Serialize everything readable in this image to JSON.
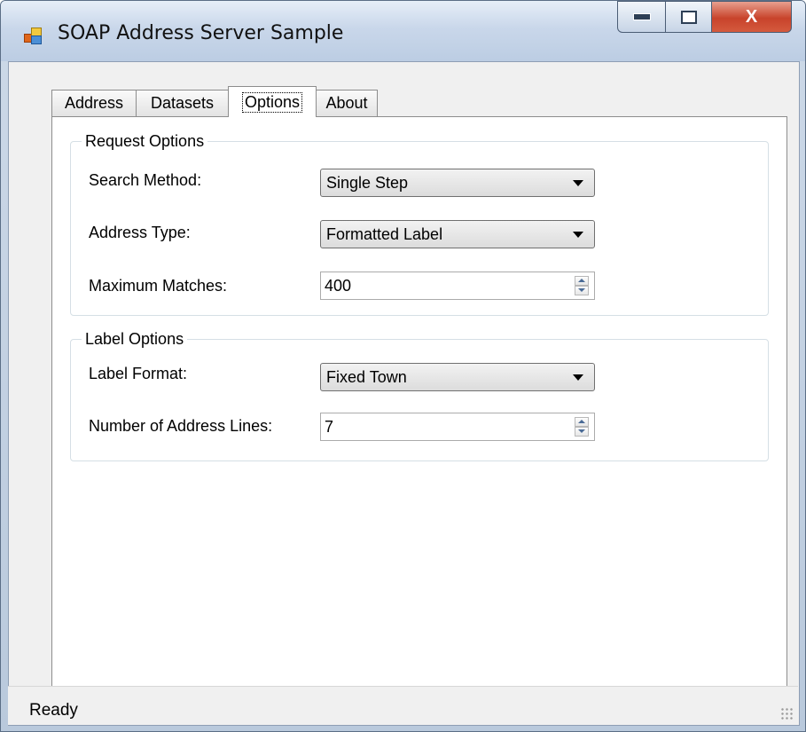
{
  "window": {
    "title": "SOAP Address Server Sample",
    "close_glyph": "X"
  },
  "tabs": [
    {
      "label": "Address"
    },
    {
      "label": "Datasets"
    },
    {
      "label": "Options",
      "selected": true
    },
    {
      "label": "About"
    }
  ],
  "request_options": {
    "legend": "Request Options",
    "search_method": {
      "label": "Search Method:",
      "value": "Single Step"
    },
    "address_type": {
      "label": "Address Type:",
      "value": "Formatted Label"
    },
    "maximum_matches": {
      "label": "Maximum Matches:",
      "value": "400"
    }
  },
  "label_options": {
    "legend": "Label Options",
    "label_format": {
      "label": "Label Format:",
      "value": "Fixed Town"
    },
    "address_lines": {
      "label": "Number of Address Lines:",
      "value": "7"
    }
  },
  "status": {
    "text": "Ready"
  }
}
